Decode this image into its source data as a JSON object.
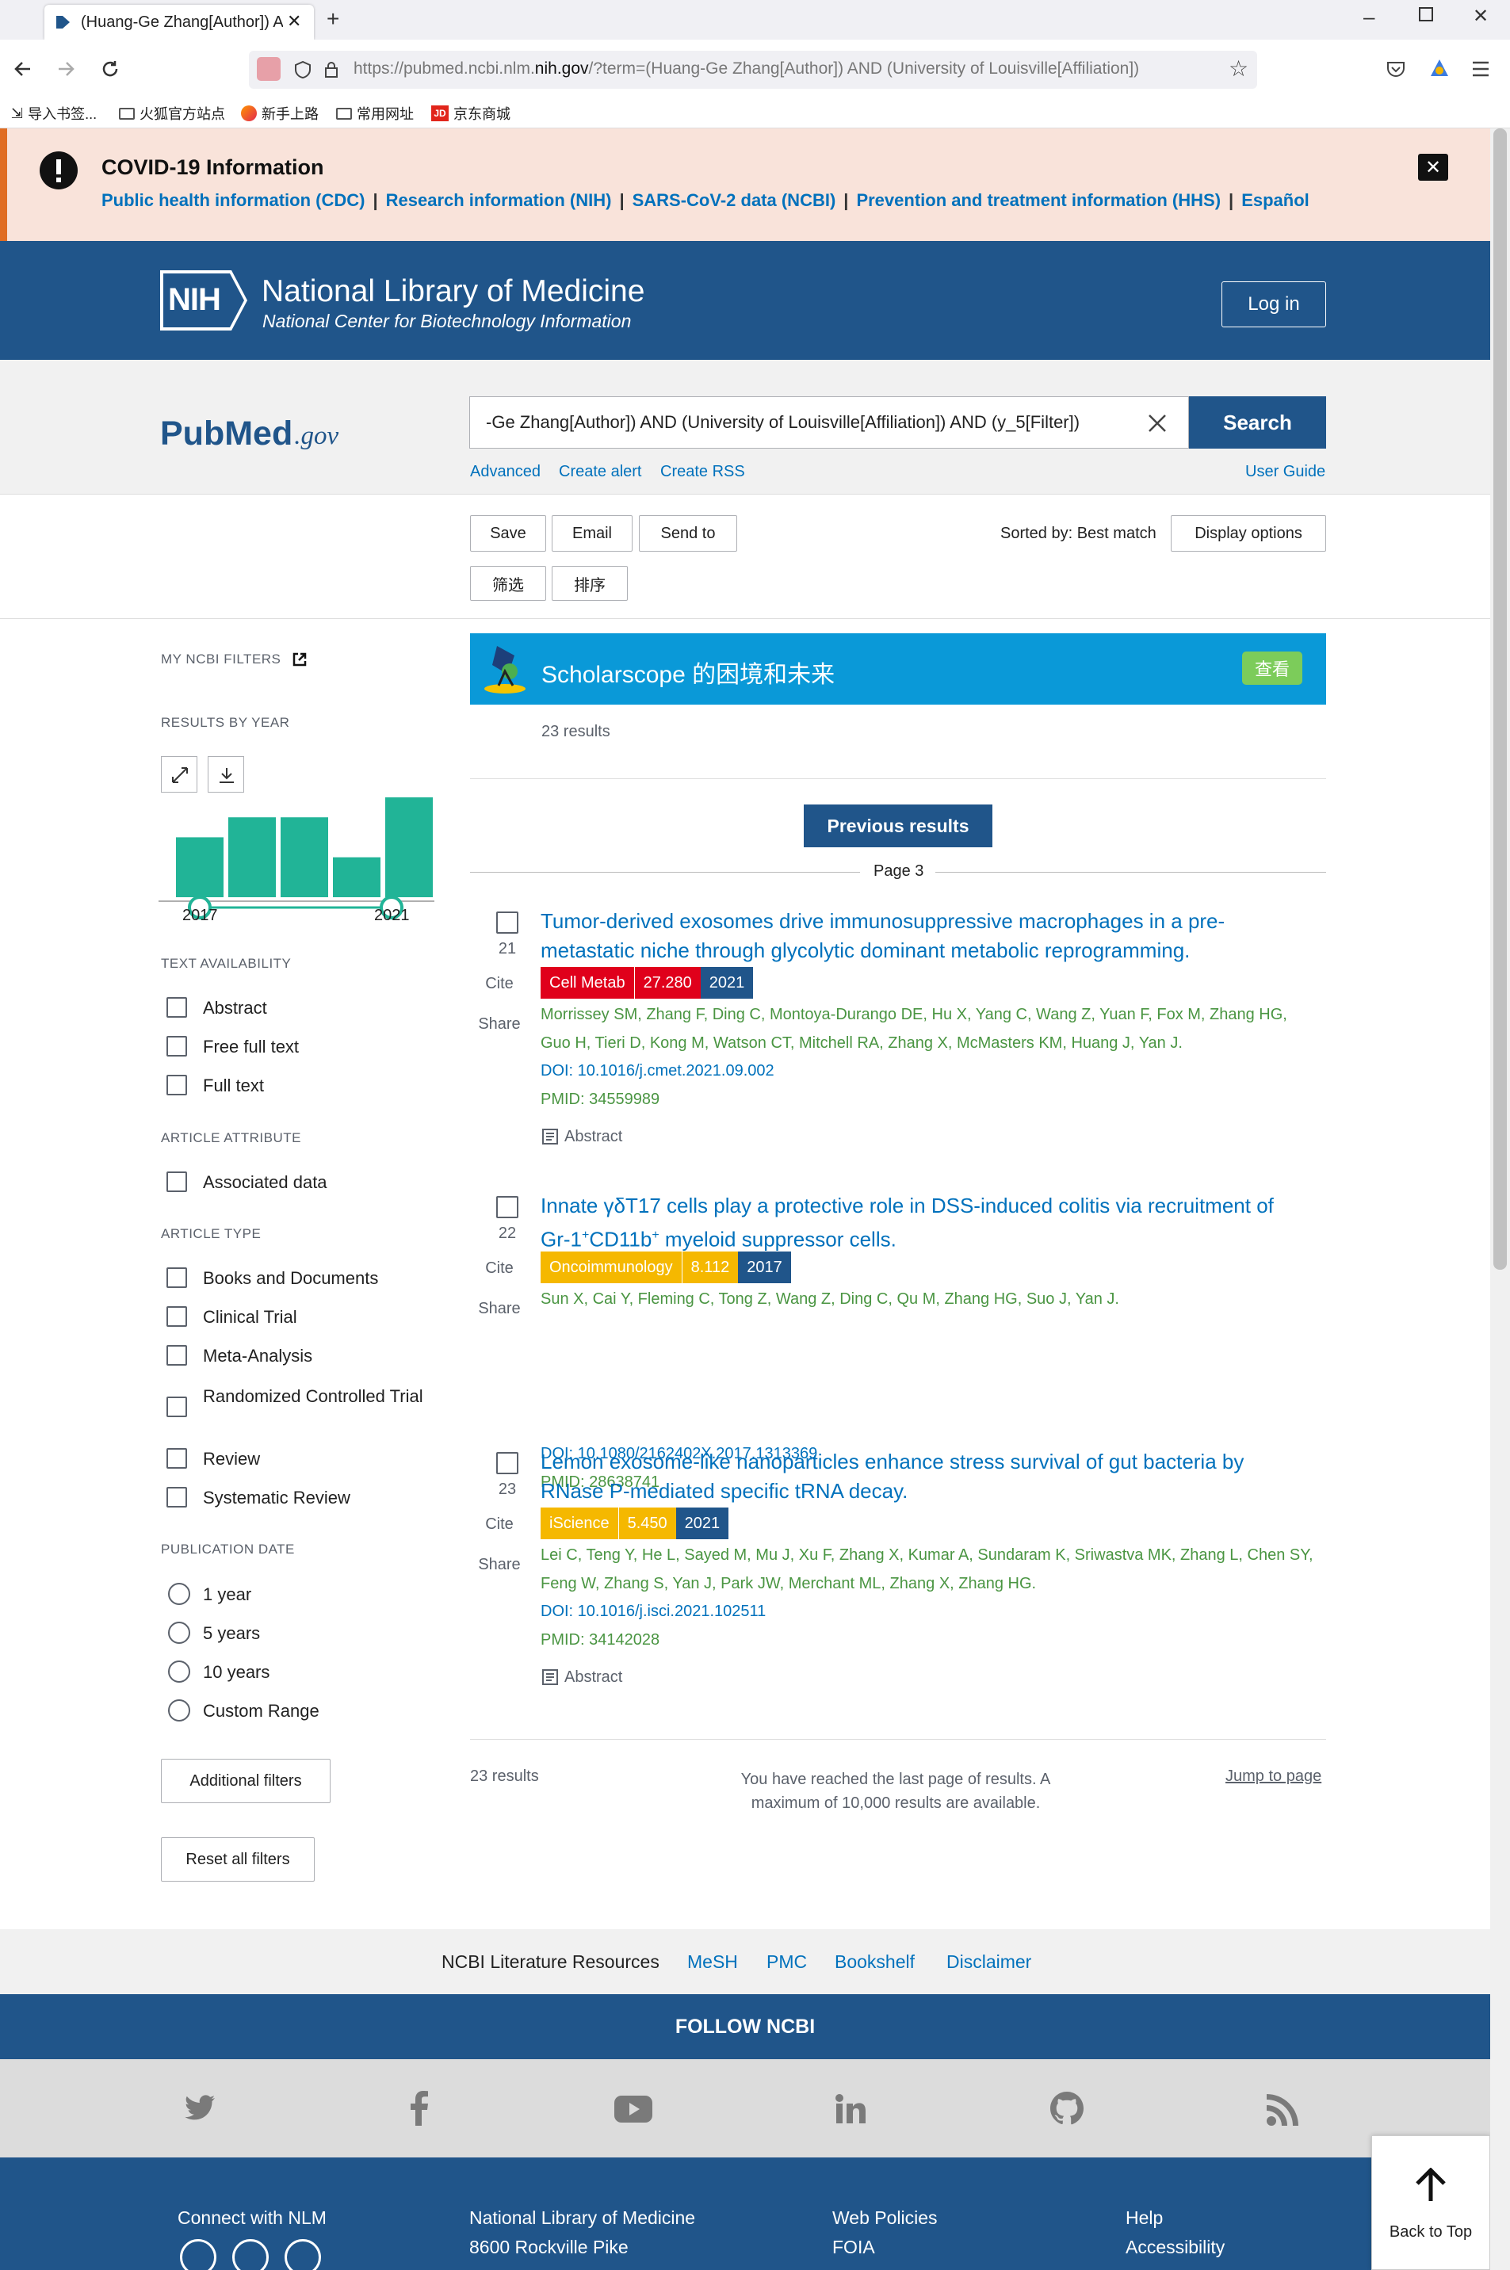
{
  "browser": {
    "tab_title": "(Huang-Ge Zhang[Author]) A",
    "url_prefix": "https://pubmed.ncbi.nlm.",
    "url_domain": "nih.gov",
    "url_rest": "/?term=(Huang-Ge Zhang[Author]) AND (University of Louisville[Affiliation])",
    "bookmarks": [
      "导入书签...",
      "火狐官方站点",
      "新手上路",
      "常用网址",
      "京东商城"
    ]
  },
  "covid": {
    "title": "COVID-19 Information",
    "links": [
      "Public health information (CDC)",
      "Research information (NIH)",
      "SARS-CoV-2 data (NCBI)",
      "Prevention and treatment information (HHS)",
      "Español"
    ]
  },
  "nlm": {
    "badge": "NIH",
    "title": "National Library of Medicine",
    "subtitle": "National Center for Biotechnology Information",
    "login": "Log in"
  },
  "search": {
    "logo_pub": "Pub",
    "logo_med": "Med",
    "logo_gov": ".gov",
    "query": "-Ge Zhang[Author]) AND (University of Louisville[Affiliation]) AND (y_5[Filter])",
    "button": "Search",
    "advanced": "Advanced",
    "create_alert": "Create alert",
    "create_rss": "Create RSS",
    "user_guide": "User Guide"
  },
  "toolbar": {
    "save": "Save",
    "email": "Email",
    "send_to": "Send to",
    "filter": "筛选",
    "sort": "排序",
    "sorted_by": "Sorted by: Best match",
    "display_options": "Display options"
  },
  "sidebar": {
    "my_filters": "MY NCBI FILTERS",
    "results_by_year": "RESULTS BY YEAR",
    "year_start": "2017",
    "year_end": "2021",
    "text_availability": "TEXT AVAILABILITY",
    "text_items": [
      "Abstract",
      "Free full text",
      "Full text"
    ],
    "article_attribute": "ARTICLE ATTRIBUTE",
    "attribute_items": [
      "Associated data"
    ],
    "article_type": "ARTICLE TYPE",
    "type_items": [
      "Books and Documents",
      "Clinical Trial",
      "Meta-Analysis",
      "Randomized Controlled Trial",
      "Review",
      "Systematic Review"
    ],
    "publication_date": "PUBLICATION DATE",
    "date_items": [
      "1 year",
      "5 years",
      "10 years",
      "Custom Range"
    ],
    "additional_filters": "Additional filters",
    "reset_filters": "Reset all filters"
  },
  "chart_data": {
    "type": "bar",
    "categories": [
      "2017",
      "2018",
      "2019",
      "2020",
      "2021"
    ],
    "values": [
      3,
      4,
      4,
      2,
      5
    ]
  },
  "banner": {
    "text": "Scholarscope 的困境和未来",
    "button": "查看"
  },
  "results": {
    "count_top": "23 results",
    "previous": "Previous results",
    "page": "Page 3",
    "cite": "Cite",
    "share": "Share",
    "abstract": "Abstract",
    "articles": [
      {
        "num": "21",
        "title_1": "Tumor-derived exosomes drive immunosuppressive macrophages in a pre-",
        "title_2": "metastatic niche through glycolytic dominant metabolic reprogramming.",
        "journal": "Cell Metab",
        "impact": "27.280",
        "year": "2021",
        "journal_color": "#e0001b",
        "authors_1": "Morrissey SM, Zhang F, Ding C, Montoya-Durango DE, Hu X, Yang C, Wang Z, Yuan F, Fox M, Zhang HG,",
        "authors_2": "Guo H, Tieri D, Kong M, Watson CT, Mitchell RA, Zhang X, McMasters KM, Huang J, Yan J.",
        "doi": "DOI: 10.1016/j.cmet.2021.09.002",
        "pmid": "PMID: 34559989"
      },
      {
        "num": "22",
        "title_1": "Innate γδT17 cells play a protective role in DSS-induced colitis via recruitment of",
        "title_2a": "Gr-1",
        "title_2sup1": "+",
        "title_2b": "CD11b",
        "title_2sup2": "+",
        "title_2c": " myeloid suppressor cells.",
        "journal": "Oncoimmunology",
        "impact": "8.112",
        "year": "2017",
        "journal_color": "#f5b800",
        "authors_1": "Sun X, Cai Y, Fleming C, Tong Z, Wang Z, Ding C, Qu M, Zhang HG, Suo J, Yan J.",
        "doi": "DOI: 10.1080/2162402X.2017.1313369",
        "pmid": "PMID: 28638741"
      },
      {
        "num": "23",
        "title_1": "Lemon exosome-like nanoparticles enhance stress survival of gut bacteria by",
        "title_2": "RNase P-mediated specific tRNA decay.",
        "journal": "iScience",
        "impact": "5.450",
        "year": "2021",
        "journal_color": "#f5b800",
        "authors_1": "Lei C, Teng Y, He L, Sayed M, Mu J, Xu F, Zhang X, Kumar A, Sundaram K, Sriwastva MK, Zhang L, Chen SY,",
        "authors_2": "Feng W, Zhang S, Yan J, Park JW, Merchant ML, Zhang X, Zhang HG.",
        "doi": "DOI: 10.1016/j.isci.2021.102511",
        "pmid": "PMID: 34142028"
      }
    ],
    "count_bottom": "23 results",
    "end_msg_1": "You have reached the last page of results. A",
    "end_msg_2": "maximum of 10,000 results are available.",
    "jump": "Jump to page"
  },
  "footer": {
    "links": [
      "NCBI Literature Resources",
      "MeSH",
      "PMC",
      "Bookshelf",
      "Disclaimer"
    ],
    "follow": "FOLLOW NCBI",
    "connect": "Connect with NLM",
    "nlm_name": "National Library of Medicine",
    "nlm_addr": "8600 Rockville Pike",
    "web_policies": "Web Policies",
    "foia": "FOIA",
    "help": "Help",
    "accessibility": "Accessibility",
    "back_to_top": "Back to Top"
  }
}
